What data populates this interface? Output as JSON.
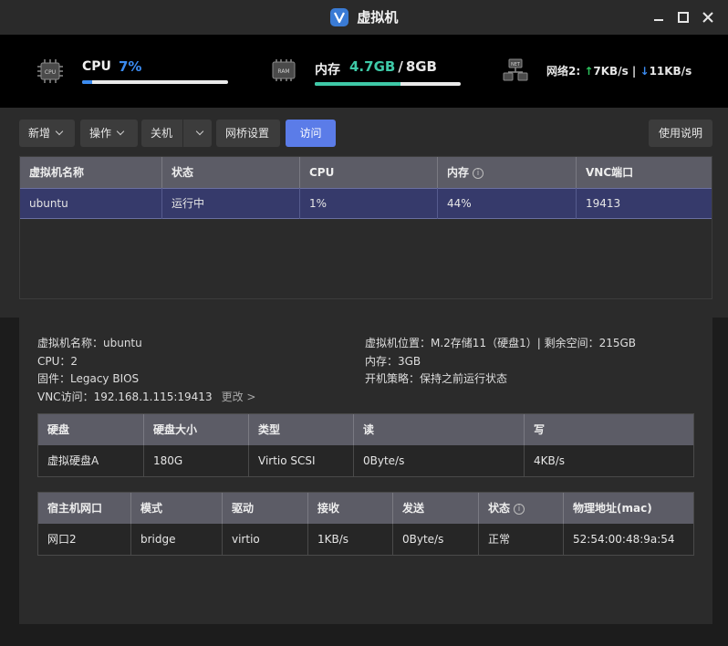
{
  "window": {
    "title": "虚拟机",
    "app_icon": "vm-app-icon"
  },
  "stats": {
    "cpu": {
      "label": "CPU",
      "value": "7%",
      "percent": 7,
      "chip_icon": "cpu-chip-icon",
      "chip_text": "CPU"
    },
    "memory": {
      "label": "内存",
      "used": "4.7GB",
      "separator": "/",
      "total": "8GB",
      "percent": 59,
      "chip_icon": "ram-chip-icon",
      "chip_text": "RAM"
    },
    "network": {
      "label": "网络2:",
      "up_arrow": "↑",
      "up": "7KB/s",
      "divider": "|",
      "down_arrow": "↓",
      "down": "11KB/s",
      "icon": "network-icon",
      "icon_text": "NET"
    }
  },
  "toolbar": {
    "new_label": "新增",
    "ops_label": "操作",
    "power_label": "关机",
    "bridge_label": "网桥设置",
    "visit_label": "访问",
    "help_label": "使用说明"
  },
  "vm_table": {
    "columns": [
      "虚拟机名称",
      "状态",
      "CPU",
      "内存",
      "VNC端口"
    ],
    "rows": [
      {
        "name": "ubuntu",
        "status": "运行中",
        "cpu": "1%",
        "memory": "44%",
        "vnc": "19413"
      }
    ]
  },
  "details": {
    "name": "虚拟机名称：ubuntu",
    "cpu": "CPU：2",
    "firmware": "固件：Legacy BIOS",
    "vnc": "VNC访问：192.168.1.115:19413",
    "vnc_change": "更改 >",
    "location": "虚拟机位置：M.2存储11（硬盘1）| 剩余空间：215GB",
    "memory": "内存：3GB",
    "boot_policy": "开机策略：保持之前运行状态"
  },
  "disk_table": {
    "columns": [
      "硬盘",
      "硬盘大小",
      "类型",
      "读",
      "写"
    ],
    "rows": [
      {
        "disk": "虚拟硬盘A",
        "size": "180G",
        "type": "Virtio SCSI",
        "read": "0Byte/s",
        "write": "4KB/s"
      }
    ]
  },
  "port_table": {
    "columns": [
      "宿主机网口",
      "模式",
      "驱动",
      "接收",
      "发送",
      "状态",
      "物理地址(mac)"
    ],
    "rows": [
      {
        "port": "网口2",
        "mode": "bridge",
        "driver": "virtio",
        "rx": "1KB/s",
        "tx": "0Byte/s",
        "status": "正常",
        "mac": "52:54:00:48:9a:54"
      }
    ]
  },
  "colors": {
    "accent_blue": "#3b8bf0",
    "mem_green": "#3ec9a7",
    "visit_button": "#5b7ce8",
    "selected_row": "#363a6b",
    "net_up": "#2ec45e"
  }
}
